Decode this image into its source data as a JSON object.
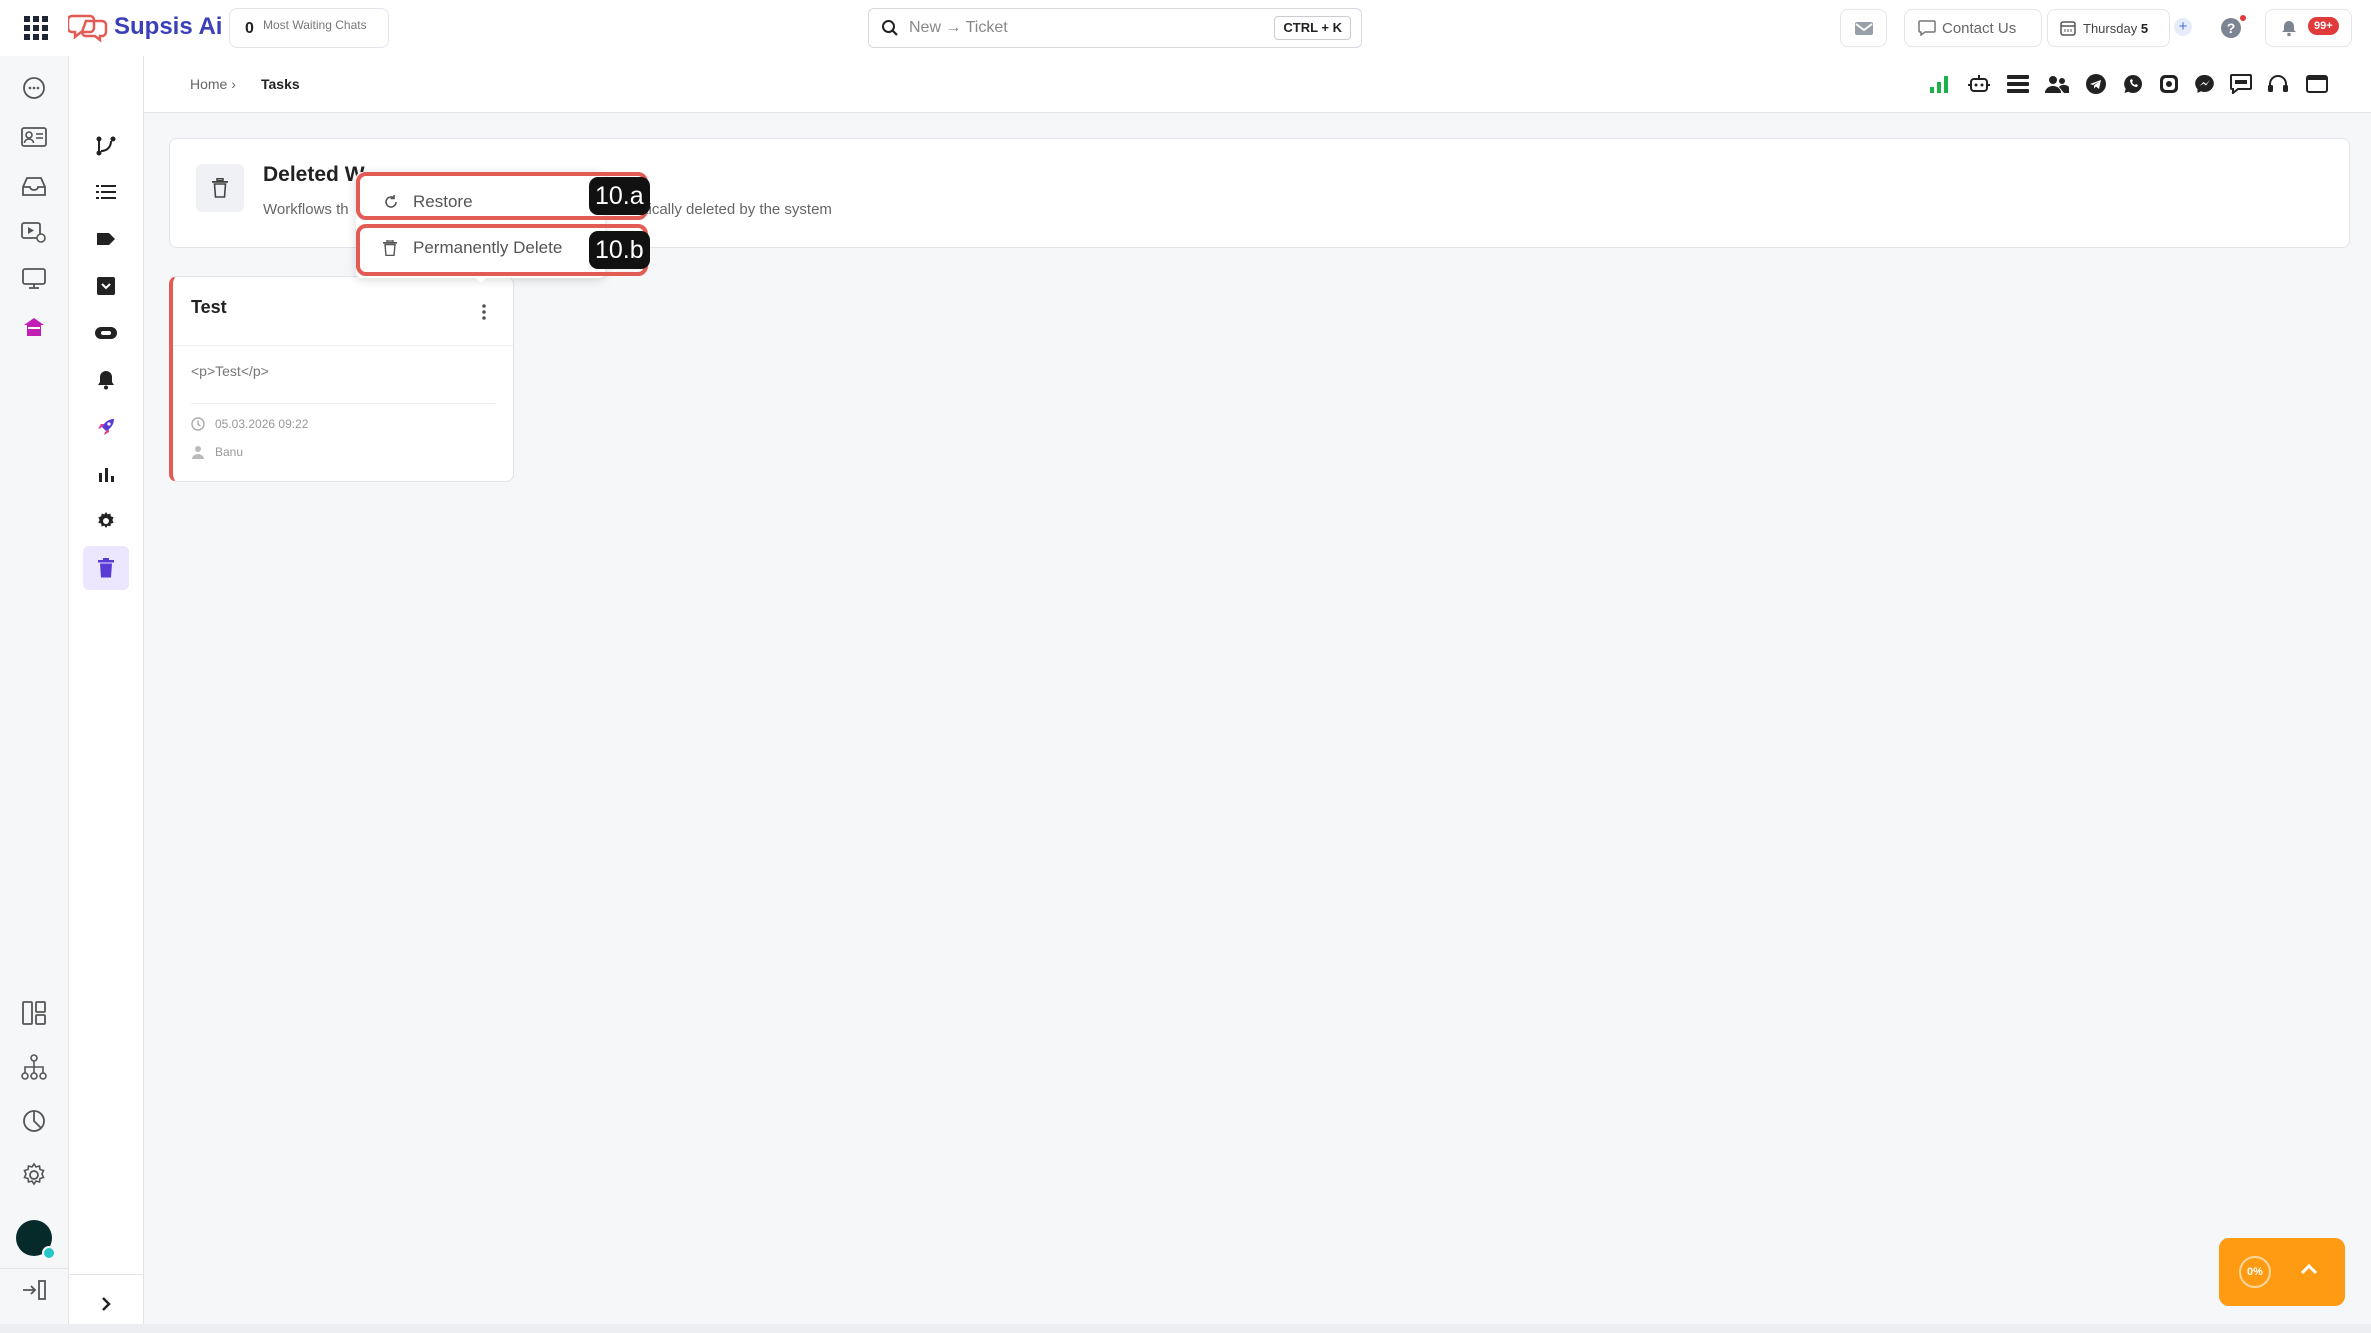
{
  "topbar": {
    "brand": "Supsis Ai",
    "waiting_count": "0",
    "waiting_label": "Most Waiting Chats",
    "search_placeholder": "New → Ticket",
    "search_shortcut": "CTRL + K",
    "contact_label": "Contact Us",
    "date_day": "Thursday",
    "date_num": "5",
    "notif_badge": "99+"
  },
  "breadcrumb": {
    "home": "Home ›",
    "current": "Tasks"
  },
  "header": {
    "title": "Deleted Workflows",
    "title_visible": "Deleted W",
    "subtitle_left": "Workflows th",
    "subtitle_right": "atically deleted by the system"
  },
  "task": {
    "title": "Test",
    "description": "<p>Test</p>",
    "date": "05.03.2026 09:22",
    "user": "Banu"
  },
  "menu": {
    "restore": "Restore",
    "delete": "Permanently Delete",
    "badge_a": "10.a",
    "badge_b": "10.b"
  },
  "progress": {
    "percent_label": "0%"
  },
  "colors": {
    "accent": "#3b3fb8",
    "highlight": "#e25b54",
    "orange": "#ff9b13",
    "active_purple": "#6c3fd1"
  }
}
